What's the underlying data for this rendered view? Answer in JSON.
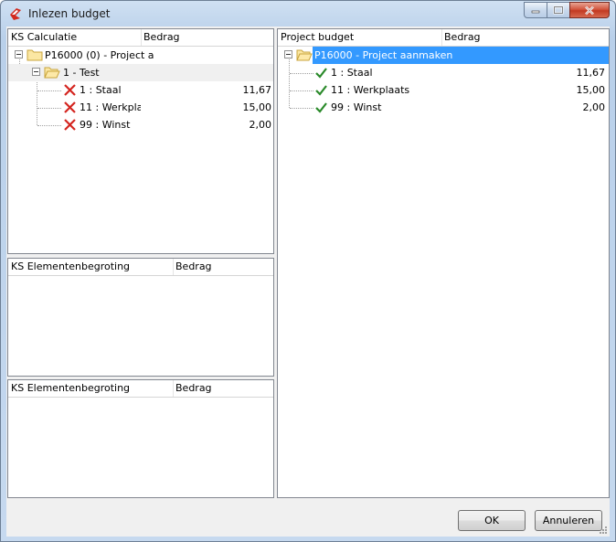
{
  "window": {
    "title": "Inlezen budget"
  },
  "left_top": {
    "headers": [
      "KS Calculatie",
      "Bedrag"
    ],
    "root": "P16000 (0) - Project a",
    "group": "1 - Test",
    "items": [
      {
        "label": "1 : Staal",
        "value": "11,67",
        "status": "error"
      },
      {
        "label": "11 : Werkplaa",
        "value": "15,00",
        "status": "error"
      },
      {
        "label": "99 : Winst",
        "value": "2,00",
        "status": "error"
      }
    ]
  },
  "left_mid": {
    "headers": [
      "KS Elementenbegroting",
      "Bedrag"
    ]
  },
  "left_bottom": {
    "headers": [
      "KS Elementenbegroting",
      "Bedrag"
    ]
  },
  "right": {
    "headers": [
      "Project budget",
      "Bedrag"
    ],
    "root": "P16000 - Project aanmaken",
    "items": [
      {
        "label": "1 : Staal",
        "value": "11,67",
        "status": "ok"
      },
      {
        "label": "11 : Werkplaats",
        "value": "15,00",
        "status": "ok"
      },
      {
        "label": "99 : Winst",
        "value": "2,00",
        "status": "ok"
      }
    ]
  },
  "buttons": {
    "ok": "OK",
    "cancel": "Annuleren"
  },
  "colors": {
    "selection": "#3399ff",
    "error": "#d4251f",
    "ok": "#2a8a2a"
  }
}
